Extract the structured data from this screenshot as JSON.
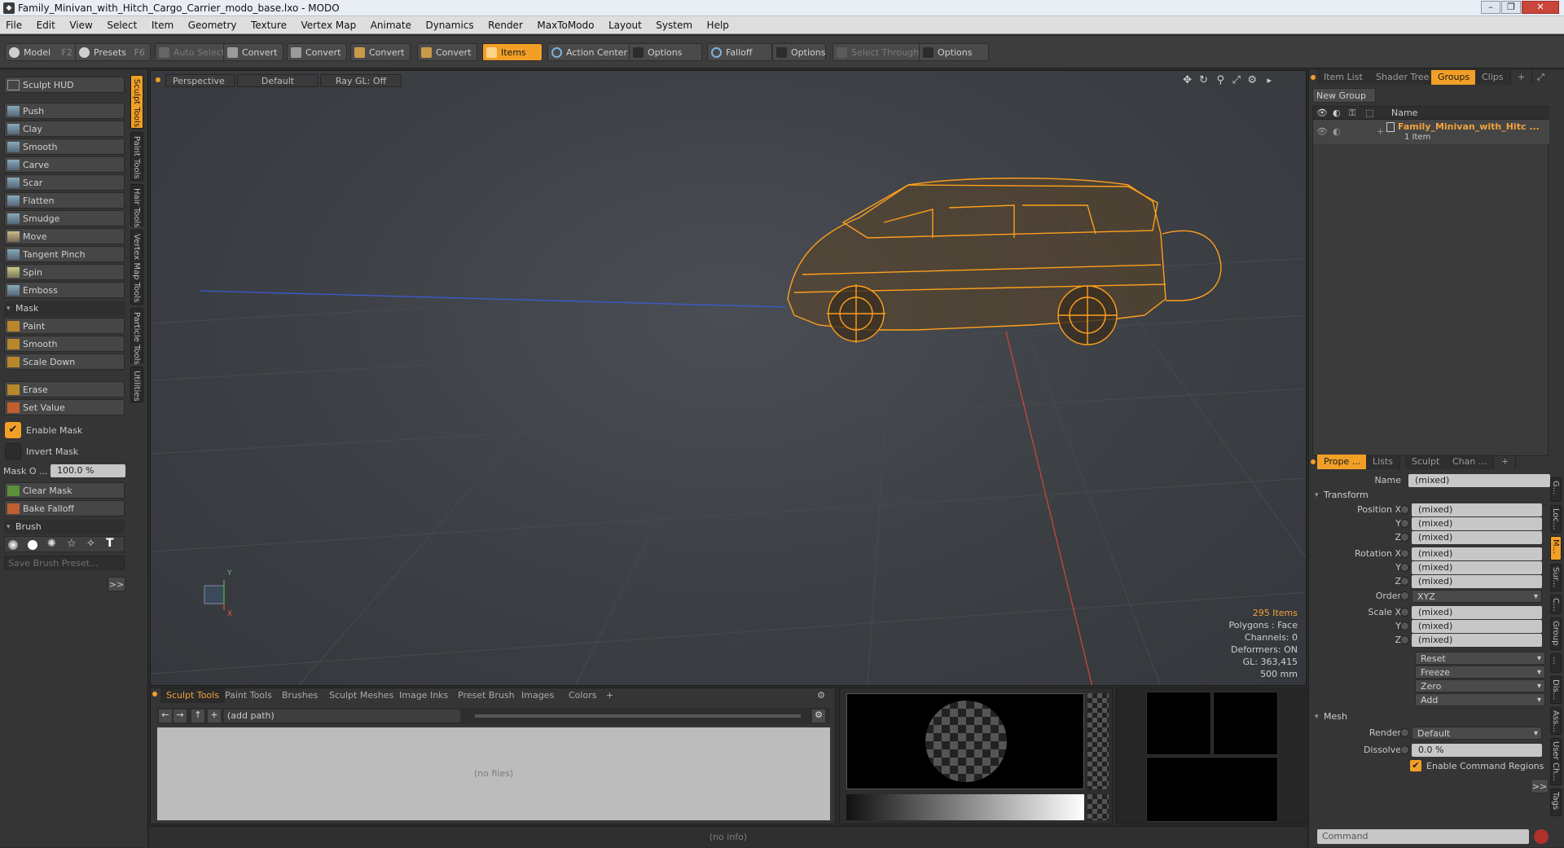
{
  "window": {
    "title": "Family_Minivan_with_Hitch_Cargo_Carrier_modo_base.lxo - MODO"
  },
  "menu": [
    "File",
    "Edit",
    "View",
    "Select",
    "Item",
    "Geometry",
    "Texture",
    "Vertex Map",
    "Animate",
    "Dynamics",
    "Render",
    "MaxToModo",
    "Layout",
    "System",
    "Help"
  ],
  "toolbar": {
    "model": "Model",
    "model_key": "F2",
    "presets": "Presets",
    "presets_key": "F6",
    "auto_select": "Auto Select",
    "convert": "Convert",
    "items": "Items",
    "action_center": "Action Center",
    "options": "Options",
    "falloff": "Falloff",
    "select_through": "Select Through"
  },
  "left": {
    "hud": "Sculpt HUD",
    "tools": [
      "Push",
      "Clay",
      "Smooth",
      "Carve",
      "Scar",
      "Flatten",
      "Smudge",
      "Move",
      "Tangent Pinch",
      "Spin",
      "Emboss"
    ],
    "mask_header": "Mask",
    "mask_tools": [
      "Paint",
      "Smooth",
      "Scale Down"
    ],
    "erase": "Erase",
    "set_value": "Set Value",
    "enable_mask": "Enable Mask",
    "invert_mask": "Invert Mask",
    "mask_opacity_label": "Mask O ...",
    "mask_opacity_value": "100.0 %",
    "clear_mask": "Clear Mask",
    "bake_falloff": "Bake Falloff",
    "brush_header": "Brush",
    "save_brush": "Save Brush Preset...",
    "more": ">>",
    "vtabs": [
      "Sculpt Tools",
      "Paint Tools",
      "Hair Tools",
      "Vertex Map Tools",
      "Particle Tools",
      "Utilities"
    ]
  },
  "viewport": {
    "view": "Perspective",
    "shading": "Default",
    "raygl": "Ray GL: Off",
    "stats": {
      "items": "295 Items",
      "polygons": "Polygons : Face",
      "channels": "Channels: 0",
      "deformers": "Deformers: ON",
      "gl": "GL: 363,415",
      "unit": "500 mm"
    },
    "axis_y": "Y",
    "axis_x": "X"
  },
  "bottom": {
    "tabs": [
      "Sculpt Tools",
      "Paint Tools",
      "Brushes",
      "Sculpt Meshes",
      "Image Inks",
      "Preset Brush",
      "Images",
      "Colors",
      "+"
    ],
    "path": "(add path)",
    "no_files": "(no files)"
  },
  "status": "(no info)",
  "right": {
    "top_tabs": [
      "Item List",
      "Shader Tree",
      "Groups",
      "Clips",
      "+"
    ],
    "new_group": "New Group",
    "col_name": "Name",
    "group_name": "Family_Minivan_with_Hitc ...",
    "group_count": "1 Item",
    "prop_tabs": [
      "Prope ...",
      "Lists",
      "Sculpt",
      "Chan ...",
      "+"
    ],
    "name_label": "Name",
    "name_value": "(mixed)",
    "transform": "Transform",
    "position_x": "Position X",
    "rotation_x": "Rotation X",
    "scale_x": "Scale X",
    "y": "Y",
    "z": "Z",
    "mixed": "(mixed)",
    "order_label": "Order",
    "order_value": "XYZ",
    "reset": "Reset",
    "freeze": "Freeze",
    "zero": "Zero",
    "add": "Add",
    "mesh": "Mesh",
    "render_label": "Render",
    "render_value": "Default",
    "dissolve_label": "Dissolve",
    "dissolve_value": "0.0 %",
    "enable_cmd": "Enable Command Regions",
    "more": ">>",
    "command": "Command",
    "side_tabs": [
      "G...",
      "Loc...",
      "M...",
      "Sur...",
      "C...",
      "Group",
      "...",
      "Dis...",
      "Ass...",
      "User Ch...",
      "Tags"
    ]
  },
  "colors": {
    "accent": "#f29f27",
    "wire": "#ff9f1c"
  }
}
